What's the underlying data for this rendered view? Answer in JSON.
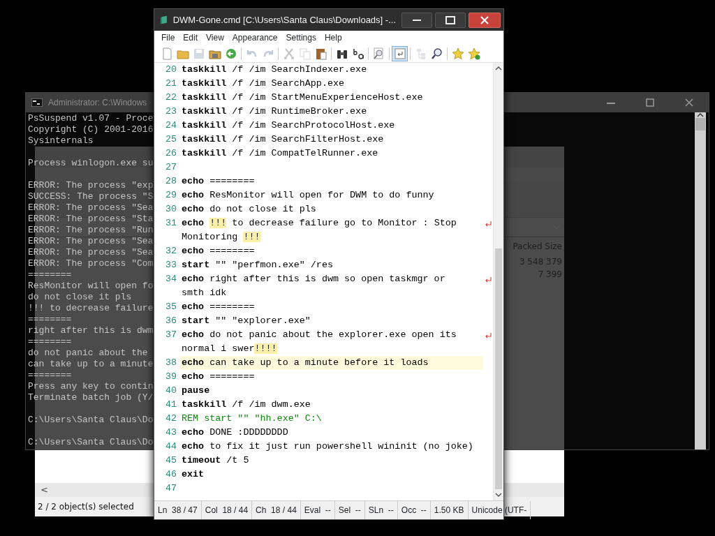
{
  "background_window": {
    "column_header": "Packed Size",
    "values": [
      "3 548 379",
      "7 399"
    ],
    "status": "2 / 2 object(s) selected",
    "scroll_left": "<"
  },
  "console": {
    "title": "Administrator: C:\\Windows",
    "blocks": [
      [
        "PsSuspend v1.07 - Proce",
        "Copyright (C) 2001-2016",
        "Sysinternals"
      ],
      [
        "Process winlogon.exe su"
      ],
      [
        "ERROR: The process \"exp",
        "SUCCESS: The process \"S",
        "ERROR: The process \"Sea",
        "ERROR: The process \"Sta",
        "ERROR: The process \"Run",
        "ERROR: The process \"Sea",
        "ERROR: The process \"Sea",
        "ERROR: The process \"Com",
        "========",
        "ResMonitor will open fo",
        "do not close it pls",
        "!!! to decrease failure",
        "========",
        "right after this is dwm",
        "========",
        "do not panic about the",
        "can take up to a minute",
        "========",
        "Press any key to contin",
        "Terminate batch job (Y/"
      ],
      [
        "C:\\Users\\Santa Claus\\Do"
      ],
      [
        "C:\\Users\\Santa Claus\\Do"
      ]
    ]
  },
  "editor": {
    "title": "DWM-Gone.cmd [C:\\Users\\Santa Claus\\Downloads] -...",
    "menu": [
      "File",
      "Edit",
      "View",
      "Appearance",
      "Settings",
      "Help"
    ],
    "toolbar": [
      {
        "kind": "new",
        "disabled": false,
        "on": false
      },
      {
        "kind": "open",
        "disabled": false,
        "on": false
      },
      {
        "kind": "save",
        "disabled": true,
        "on": false
      },
      {
        "kind": "save-as",
        "disabled": false,
        "on": false
      },
      {
        "kind": "reload",
        "disabled": false,
        "on": false
      },
      {
        "kind": "separator"
      },
      {
        "kind": "undo",
        "disabled": true,
        "on": false
      },
      {
        "kind": "redo",
        "disabled": true,
        "on": false
      },
      {
        "kind": "separator"
      },
      {
        "kind": "cut",
        "disabled": true,
        "on": false
      },
      {
        "kind": "copy",
        "disabled": true,
        "on": false
      },
      {
        "kind": "paste",
        "disabled": false,
        "on": false
      },
      {
        "kind": "separator"
      },
      {
        "kind": "find",
        "disabled": false,
        "on": false
      },
      {
        "kind": "replace",
        "disabled": false,
        "on": false
      },
      {
        "kind": "separator"
      },
      {
        "kind": "zoom-page",
        "disabled": false,
        "on": false
      },
      {
        "kind": "separator"
      },
      {
        "kind": "wrap",
        "disabled": false,
        "on": true
      },
      {
        "kind": "separator"
      },
      {
        "kind": "tree",
        "disabled": true,
        "on": false
      },
      {
        "kind": "zoom",
        "disabled": false,
        "on": false
      },
      {
        "kind": "separator"
      },
      {
        "kind": "favorite",
        "disabled": false,
        "on": false
      },
      {
        "kind": "add-favorite",
        "disabled": false,
        "on": false
      }
    ],
    "lines": [
      {
        "number": "20",
        "current": false,
        "rows": [
          [
            {
              "kind": "keyword",
              "text": "taskkill"
            },
            {
              "kind": "plain",
              "text": " /f /im SearchIndexer.exe"
            }
          ]
        ]
      },
      {
        "number": "21",
        "current": false,
        "rows": [
          [
            {
              "kind": "keyword",
              "text": "taskkill"
            },
            {
              "kind": "plain",
              "text": " /f /im SearchApp.exe"
            }
          ]
        ]
      },
      {
        "number": "22",
        "current": false,
        "rows": [
          [
            {
              "kind": "keyword",
              "text": "taskkill"
            },
            {
              "kind": "plain",
              "text": " /f /im StartMenuExperienceHost.exe"
            }
          ]
        ]
      },
      {
        "number": "23",
        "current": false,
        "rows": [
          [
            {
              "kind": "keyword",
              "text": "taskkill"
            },
            {
              "kind": "plain",
              "text": " /f /im RuntimeBroker.exe"
            }
          ]
        ]
      },
      {
        "number": "24",
        "current": false,
        "rows": [
          [
            {
              "kind": "keyword",
              "text": "taskkill"
            },
            {
              "kind": "plain",
              "text": " /f /im SearchProtocolHost.exe"
            }
          ]
        ]
      },
      {
        "number": "25",
        "current": false,
        "rows": [
          [
            {
              "kind": "keyword",
              "text": "taskkill"
            },
            {
              "kind": "plain",
              "text": " /f /im SearchFilterHost.exe"
            }
          ]
        ]
      },
      {
        "number": "26",
        "current": false,
        "rows": [
          [
            {
              "kind": "keyword",
              "text": "taskkill"
            },
            {
              "kind": "plain",
              "text": " /f /im CompatTelRunner.exe"
            }
          ]
        ]
      },
      {
        "number": "27",
        "current": false
      },
      {
        "number": "28",
        "current": false,
        "rows": [
          [
            {
              "kind": "keyword",
              "text": "echo"
            },
            {
              "kind": "plain",
              "text": " ========"
            }
          ]
        ]
      },
      {
        "number": "29",
        "current": false,
        "rows": [
          [
            {
              "kind": "keyword",
              "text": "echo"
            },
            {
              "kind": "plain",
              "text": " ResMonitor will open for DWM to do funny"
            }
          ]
        ]
      },
      {
        "number": "30",
        "current": false,
        "rows": [
          [
            {
              "kind": "keyword",
              "text": "echo"
            },
            {
              "kind": "plain",
              "text": " do not close it pls"
            }
          ]
        ]
      },
      {
        "number": "31",
        "current": false,
        "rows": [
          [
            {
              "kind": "keyword",
              "text": "echo"
            },
            {
              "kind": "plain",
              "text": " "
            },
            {
              "kind": "mark",
              "text": "!!!"
            },
            {
              "kind": "plain",
              "text": " to decrease failure go to Monitor : Stop"
            }
          ],
          [
            {
              "kind": "plain",
              "text": "Monitoring "
            },
            {
              "kind": "mark",
              "text": "!!!"
            }
          ]
        ]
      },
      {
        "number": "32",
        "current": false,
        "rows": [
          [
            {
              "kind": "keyword",
              "text": "echo"
            },
            {
              "kind": "plain",
              "text": " ========"
            }
          ]
        ]
      },
      {
        "number": "33",
        "current": false,
        "rows": [
          [
            {
              "kind": "keyword",
              "text": "start"
            },
            {
              "kind": "plain",
              "text": " \"\" \"perfmon.exe\" /res"
            }
          ]
        ]
      },
      {
        "number": "34",
        "current": false,
        "rows": [
          [
            {
              "kind": "keyword",
              "text": "echo"
            },
            {
              "kind": "plain",
              "text": " right after this is dwm so open taskmgr or"
            }
          ],
          [
            {
              "kind": "plain",
              "text": "smth idk"
            }
          ]
        ]
      },
      {
        "number": "35",
        "current": false,
        "rows": [
          [
            {
              "kind": "keyword",
              "text": "echo"
            },
            {
              "kind": "plain",
              "text": " ========"
            }
          ]
        ]
      },
      {
        "number": "36",
        "current": false,
        "rows": [
          [
            {
              "kind": "keyword",
              "text": "start"
            },
            {
              "kind": "plain",
              "text": " \"\" \"explorer.exe\""
            }
          ]
        ]
      },
      {
        "number": "37",
        "current": false,
        "rows": [
          [
            {
              "kind": "keyword",
              "text": "echo"
            },
            {
              "kind": "plain",
              "text": " do not panic about the explorer.exe open its"
            }
          ],
          [
            {
              "kind": "plain",
              "text": "normal i swer"
            },
            {
              "kind": "mark",
              "text": "!!!!"
            }
          ]
        ]
      },
      {
        "number": "38",
        "current": true,
        "rows": [
          [
            {
              "kind": "keyword",
              "text": "echo"
            },
            {
              "kind": "plain",
              "text": " can take up to a minute before it loads"
            }
          ]
        ]
      },
      {
        "number": "39",
        "current": false,
        "rows": [
          [
            {
              "kind": "keyword",
              "text": "echo"
            },
            {
              "kind": "plain",
              "text": " ========"
            }
          ]
        ]
      },
      {
        "number": "40",
        "current": false,
        "rows": [
          [
            {
              "kind": "keyword",
              "text": "pause"
            }
          ]
        ]
      },
      {
        "number": "41",
        "current": false,
        "rows": [
          [
            {
              "kind": "keyword",
              "text": "taskkill"
            },
            {
              "kind": "plain",
              "text": " /f /im dwm.exe"
            }
          ]
        ]
      },
      {
        "number": "42",
        "current": false,
        "rows": [
          [
            {
              "kind": "comment",
              "text": "REM start \"\" \"hh.exe\" C:\\"
            }
          ]
        ]
      },
      {
        "number": "43",
        "current": false,
        "rows": [
          [
            {
              "kind": "keyword",
              "text": "echo"
            },
            {
              "kind": "plain",
              "text": " DONE :DDDDDDDD"
            }
          ]
        ]
      },
      {
        "number": "44",
        "current": false,
        "rows": [
          [
            {
              "kind": "keyword",
              "text": "echo"
            },
            {
              "kind": "plain",
              "text": " to fix it just run powershell wininit (no joke)"
            }
          ]
        ]
      },
      {
        "number": "45",
        "current": false,
        "rows": [
          [
            {
              "kind": "keyword",
              "text": "timeout"
            },
            {
              "kind": "plain",
              "text": " /t 5"
            }
          ]
        ]
      },
      {
        "number": "46",
        "current": false,
        "rows": [
          [
            {
              "kind": "keyword",
              "text": "exit"
            }
          ]
        ]
      },
      {
        "number": "47",
        "current": false
      }
    ],
    "status": [
      "Ln  38 / 47",
      "Col  18 / 44",
      "Ch  18 / 44",
      "Eval  --",
      "Sel  --",
      "SLn  --",
      "Occ  --",
      "1.50 KB",
      "Unicode (UTF-"
    ]
  }
}
